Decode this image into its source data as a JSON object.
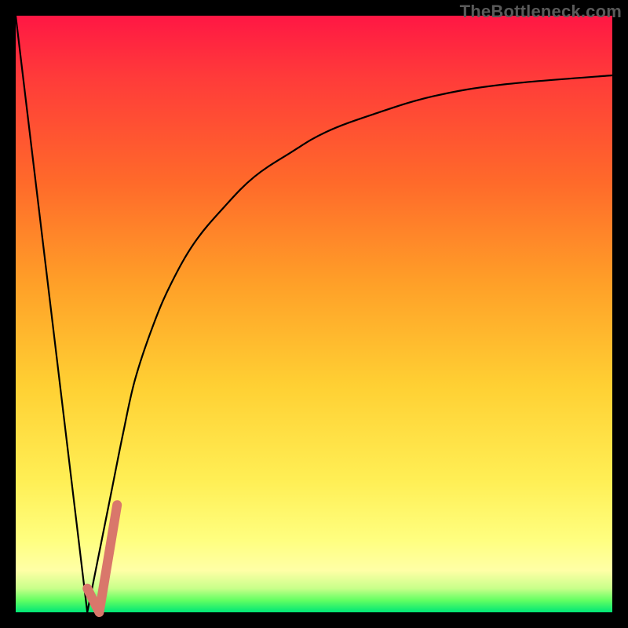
{
  "watermark": "TheBottleneck.com",
  "chart_data": {
    "type": "line",
    "title": "",
    "xlabel": "",
    "ylabel": "",
    "xlim": [
      0,
      100
    ],
    "ylim": [
      0,
      100
    ],
    "grid": false,
    "legend": false,
    "series": [
      {
        "name": "left-diagonal",
        "x": [
          0,
          12
        ],
        "values": [
          100,
          0
        ],
        "color": "#000000"
      },
      {
        "name": "right-curve",
        "x": [
          12,
          14,
          16,
          18,
          20,
          23,
          26,
          30,
          35,
          40,
          46,
          52,
          60,
          70,
          82,
          100
        ],
        "values": [
          0,
          10,
          20,
          30,
          39,
          48,
          55,
          62,
          68,
          73,
          77,
          80.5,
          83.5,
          86.5,
          88.5,
          90
        ],
        "color": "#000000"
      }
    ],
    "annotations": [
      {
        "name": "highlight-j",
        "type": "segment",
        "color": "#d9776b",
        "width": 12,
        "x": [
          12,
          14,
          17
        ],
        "y": [
          4,
          0,
          18
        ]
      }
    ]
  }
}
